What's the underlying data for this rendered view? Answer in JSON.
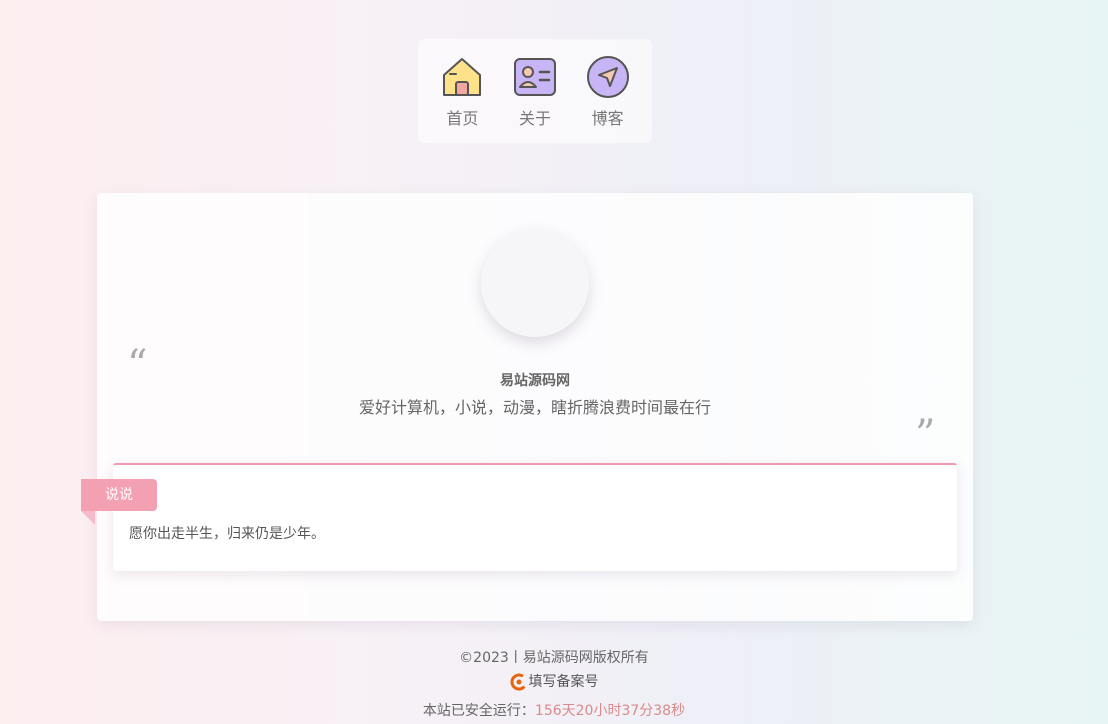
{
  "nav": {
    "items": [
      {
        "label": "首页",
        "icon": "home-icon"
      },
      {
        "label": "关于",
        "icon": "id-card-icon"
      },
      {
        "label": "博客",
        "icon": "navigation-arrow-icon"
      }
    ]
  },
  "profile": {
    "name": "易站源码网",
    "motto": "爱好计算机，小说，动漫，瞎折腾浪费时间最在行",
    "quote_open": "“",
    "quote_close": "”"
  },
  "talk": {
    "tag": "说说",
    "text": "愿你出走半生，归来仍是少年。"
  },
  "footer": {
    "copyright": "©2023丨易站源码网版权所有",
    "beian": "填写备案号",
    "runtime_label": "本站已安全运行：",
    "runtime_value": "156天20小时37分38秒"
  },
  "colors": {
    "accent_pink": "#f4a0b3",
    "runtime_color": "#d98a8a"
  }
}
